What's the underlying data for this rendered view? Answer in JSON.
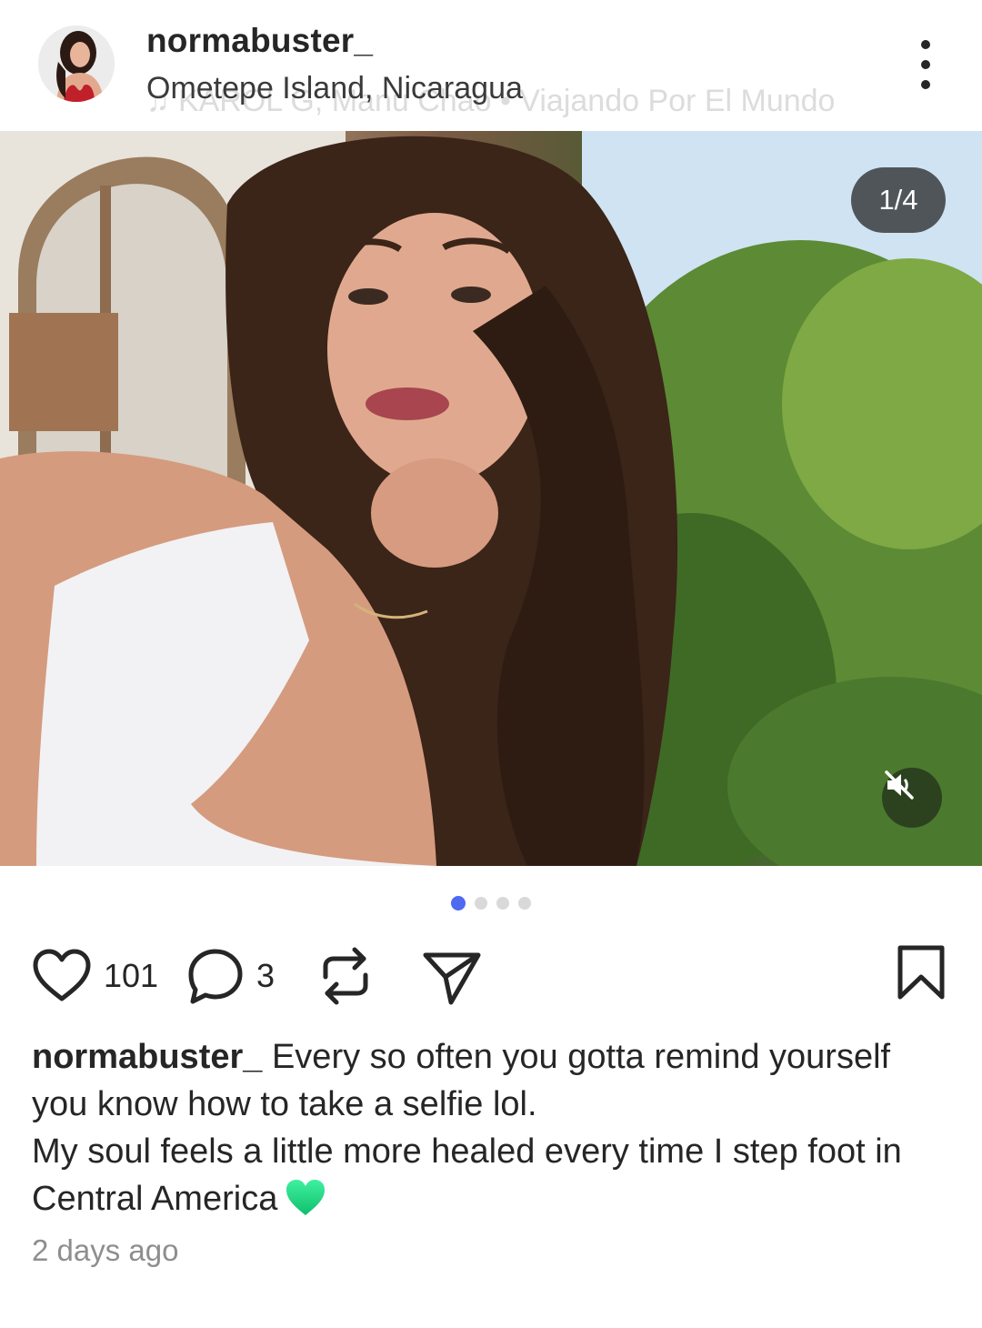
{
  "post": {
    "username": "normabuster_",
    "location": "Ometepe Island, Nicaragua",
    "music_ghost": "♫ KAROL G, Manu Chao • Viajando Por El Mundo",
    "media": {
      "counter": "1/4",
      "current_index": 1,
      "total": 4
    },
    "actions": {
      "likes": "101",
      "comments": "3"
    },
    "caption": {
      "username": "normabuster_",
      "line1": " Every so often you gotta remind yourself you know how to take a selfie lol.",
      "line2": "My soul feels a little more healed every time I step foot in Central America",
      "emoji": "green-heart"
    },
    "timestamp": "2 days ago"
  },
  "colors": {
    "text": "#262626",
    "muted": "#8e8e8e",
    "active_dot": "#4d6af0",
    "inactive_dot": "#d9d9d9"
  }
}
